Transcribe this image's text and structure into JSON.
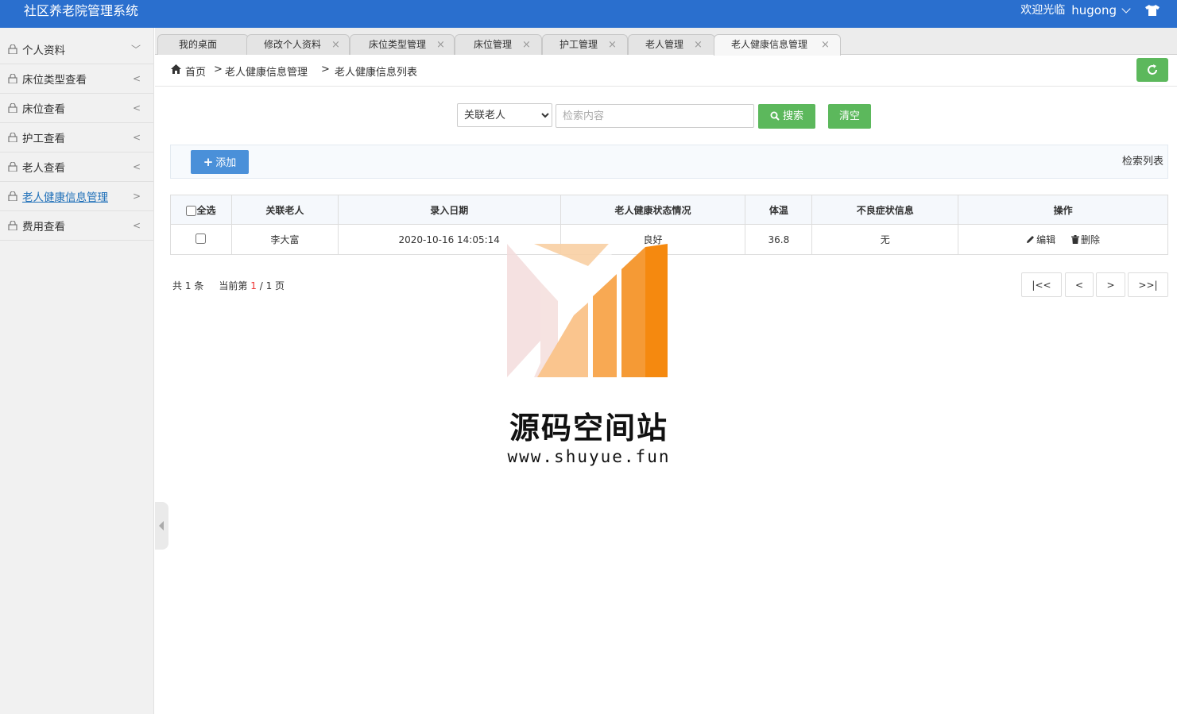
{
  "header": {
    "title": "社区养老院管理系统",
    "welcome": "欢迎光临",
    "username": "hugong"
  },
  "sidebar": {
    "items": [
      {
        "label": "个人资料",
        "arrow": "﹀"
      },
      {
        "label": "床位类型查看",
        "arrow": "<"
      },
      {
        "label": "床位查看",
        "arrow": "<"
      },
      {
        "label": "护工查看",
        "arrow": "<"
      },
      {
        "label": "老人查看",
        "arrow": "<"
      },
      {
        "label": "老人健康信息管理",
        "arrow": ">"
      },
      {
        "label": "费用查看",
        "arrow": "<"
      }
    ],
    "active_index": 5
  },
  "tabs": [
    {
      "label": "我的桌面",
      "closable": false
    },
    {
      "label": "修改个人资料",
      "closable": true
    },
    {
      "label": "床位类型管理",
      "closable": true
    },
    {
      "label": "床位管理",
      "closable": true
    },
    {
      "label": "护工管理",
      "closable": true
    },
    {
      "label": "老人管理",
      "closable": true
    },
    {
      "label": "老人健康信息管理",
      "closable": true
    }
  ],
  "breadcrumb": {
    "home": "首页",
    "sep": ">",
    "level1": "老人健康信息管理",
    "level2": "老人健康信息列表"
  },
  "search": {
    "select_value": "关联老人",
    "placeholder": "检索内容",
    "search_label": "搜索",
    "clear_label": "清空"
  },
  "toolbar": {
    "add_label": "添加",
    "title": "检索列表"
  },
  "table": {
    "select_all": "全选",
    "columns": [
      "关联老人",
      "录入日期",
      "老人健康状态情况",
      "体温",
      "不良症状信息",
      "操作"
    ],
    "rows": [
      {
        "elder": "李大富",
        "date": "2020-10-16 14:05:14",
        "status": "良好",
        "temp": "36.8",
        "symptom": "无"
      }
    ],
    "edit_label": "编辑",
    "delete_label": "删除"
  },
  "pager": {
    "total_prefix": "共",
    "total": "1",
    "total_suffix": "条",
    "current_prefix": "当前第",
    "current": "1",
    "pages": "/ 1",
    "page_suffix": "页",
    "first": "|<<",
    "prev": "<",
    "next": ">",
    "last": ">>|"
  },
  "watermark": {
    "title": "源码空间站",
    "url": "www.shuyue.fun"
  },
  "colors": {
    "header_bg": "#2a6fce",
    "green": "#5cb85c",
    "blue_button": "#4a90d9",
    "active_link": "#1e6fb8",
    "orange": "#f5890f"
  }
}
